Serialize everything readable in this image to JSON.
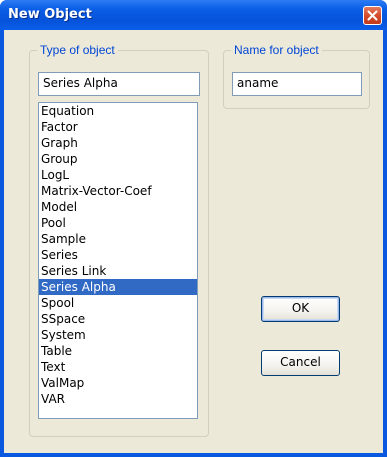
{
  "window": {
    "title": "New Object",
    "colors": {
      "titlebar": "#0A5FE6",
      "client": "#ECE9D8",
      "close": "#D24A2A",
      "selection": "#316AC5",
      "legend": "#0046D5"
    },
    "close_icon": "close-icon"
  },
  "type_group": {
    "legend": "Type of object",
    "selected_value": "Series Alpha",
    "items": [
      "Equation",
      "Factor",
      "Graph",
      "Group",
      "LogL",
      "Matrix-Vector-Coef",
      "Model",
      "Pool",
      "Sample",
      "Series",
      "Series Link",
      "Series Alpha",
      "Spool",
      "SSpace",
      "System",
      "Table",
      "Text",
      "ValMap",
      "VAR"
    ],
    "selected_index": 11
  },
  "name_group": {
    "legend": "Name for object",
    "value": "aname"
  },
  "buttons": {
    "ok_label": "OK",
    "cancel_label": "Cancel"
  }
}
